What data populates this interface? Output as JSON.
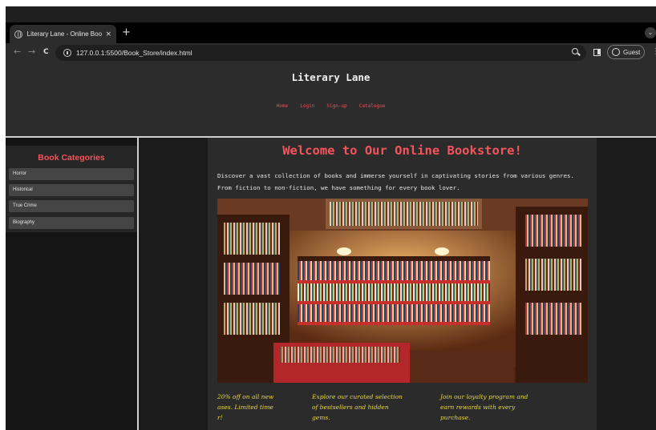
{
  "browser": {
    "tab_title": "Literary Lane - Online Books",
    "tab_close": "×",
    "new_tab": "+",
    "tab_menu": "⌄",
    "url": "127.0.0.1:5500/Book_Store/index.html",
    "back": "←",
    "forward": "→",
    "reload": "C",
    "profile_label": "Guest",
    "menu": "⋮"
  },
  "header": {
    "title": "Literary Lane",
    "nav": [
      "Home",
      "Login",
      "Sign-up",
      "Catalogue"
    ]
  },
  "sidebar": {
    "title": "Book Categories",
    "items": [
      "Horror",
      "Historical",
      "True Crime",
      "Biography"
    ]
  },
  "main": {
    "heading": "Welcome to Our Online Bookstore!",
    "intro": "Discover a vast collection of books and immerse yourself in captivating stories from various genres. From fiction to non-fiction, we have something for every book lover.",
    "promos": [
      "20% off on all new\nases. Limited time\nr!",
      "Explore our curated selection\nof bestsellers and hidden\ngems.",
      "Join our loyalty program and\nearn rewards with every\npurchase."
    ]
  },
  "colors": {
    "accent": "#f4545c",
    "nav_link": "#e8545a",
    "promo_text": "#e6d64a",
    "chrome_bg": "#2c2c2c",
    "page_bg": "#222222"
  }
}
